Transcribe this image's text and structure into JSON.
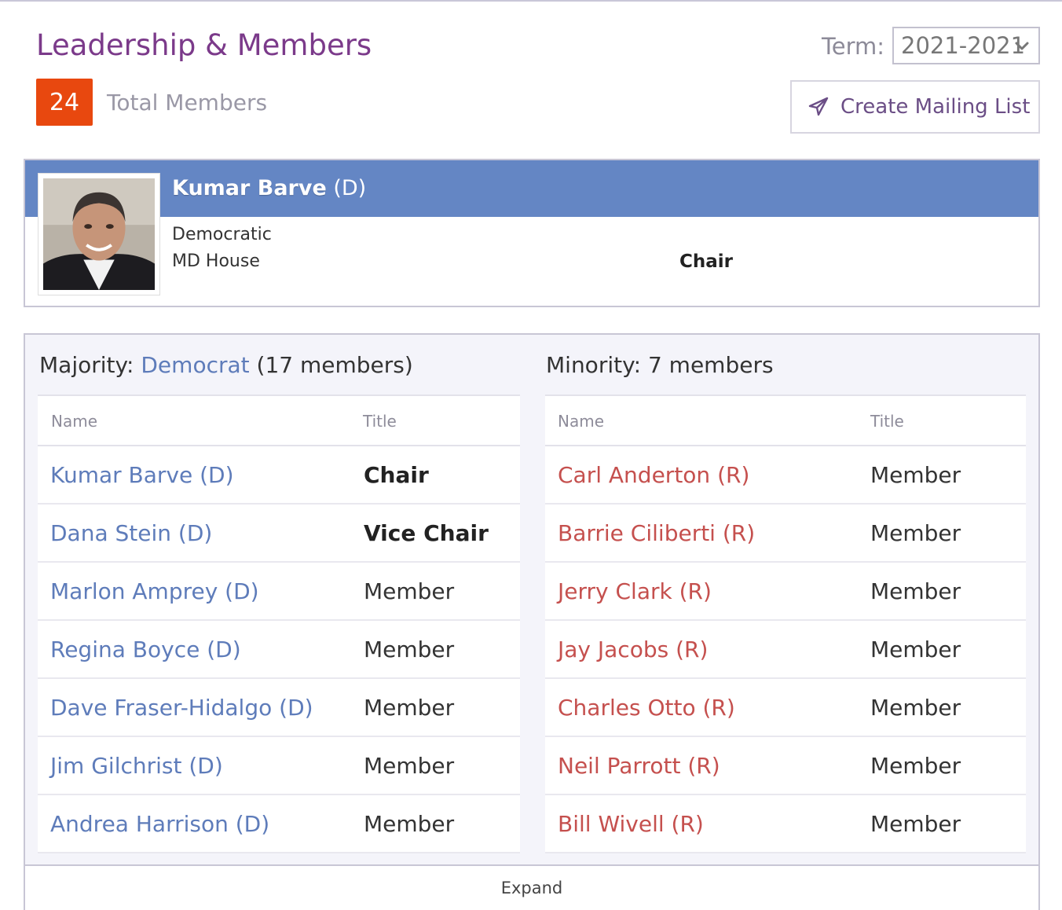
{
  "header": {
    "title": "Leadership & Members",
    "total_count": "24",
    "total_label": "Total Members",
    "term_label": "Term:",
    "term_value": "2021-2021",
    "mailing_button": "Create Mailing List"
  },
  "leader": {
    "name": "Kumar Barve",
    "party_suffix": "(D)",
    "party": "Democratic",
    "chamber": "MD House",
    "role": "Chair"
  },
  "majority": {
    "label": "Majority:",
    "party": "Democrat",
    "count_text": "(17 members)",
    "col_name": "Name",
    "col_title": "Title",
    "rows": [
      {
        "name": "Kumar Barve (D)",
        "title": "Chair"
      },
      {
        "name": "Dana Stein (D)",
        "title": "Vice Chair"
      },
      {
        "name": "Marlon Amprey (D)",
        "title": "Member"
      },
      {
        "name": "Regina Boyce (D)",
        "title": "Member"
      },
      {
        "name": "Dave Fraser-Hidalgo (D)",
        "title": "Member"
      },
      {
        "name": "Jim Gilchrist (D)",
        "title": "Member"
      },
      {
        "name": "Andrea Harrison (D)",
        "title": "Member"
      }
    ]
  },
  "minority": {
    "label": "Minority: 7 members",
    "col_name": "Name",
    "col_title": "Title",
    "rows": [
      {
        "name": "Carl Anderton (R)",
        "title": "Member"
      },
      {
        "name": "Barrie Ciliberti (R)",
        "title": "Member"
      },
      {
        "name": "Jerry Clark (R)",
        "title": "Member"
      },
      {
        "name": "Jay Jacobs (R)",
        "title": "Member"
      },
      {
        "name": "Charles Otto (R)",
        "title": "Member"
      },
      {
        "name": "Neil Parrott (R)",
        "title": "Member"
      },
      {
        "name": "Bill Wivell (R)",
        "title": "Member"
      }
    ]
  },
  "expand_label": "Expand",
  "colors": {
    "title": "#7b3a8a",
    "badge": "#e8480f",
    "band": "#6486c4",
    "democrat": "#5e7cba",
    "republican": "#c5504e"
  }
}
